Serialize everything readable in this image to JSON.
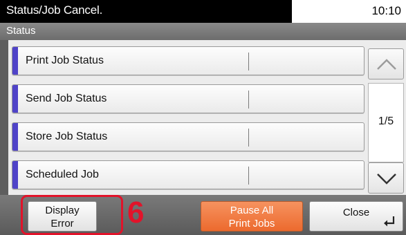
{
  "header": {
    "title": "Status/Job Cancel.",
    "clock": "10:10"
  },
  "subtitle": "Status",
  "status_items": [
    {
      "label": "Print Job Status"
    },
    {
      "label": "Send Job Status"
    },
    {
      "label": "Store Job Status"
    },
    {
      "label": "Scheduled Job"
    }
  ],
  "pager": {
    "page": "1/5",
    "up_icon": "chevron-up-icon",
    "down_icon": "chevron-down-icon"
  },
  "footer": {
    "display_error_line1": "Display",
    "display_error_line2": "Error",
    "step_number": "6",
    "pause_line1": "Pause All",
    "pause_line2": "Print Jobs",
    "close_label": "Close",
    "close_icon": "enter-return-icon"
  },
  "colors": {
    "accent_bar": "#4f43c8",
    "pause_button": "#ec6a2e",
    "highlight": "#e2132a"
  }
}
